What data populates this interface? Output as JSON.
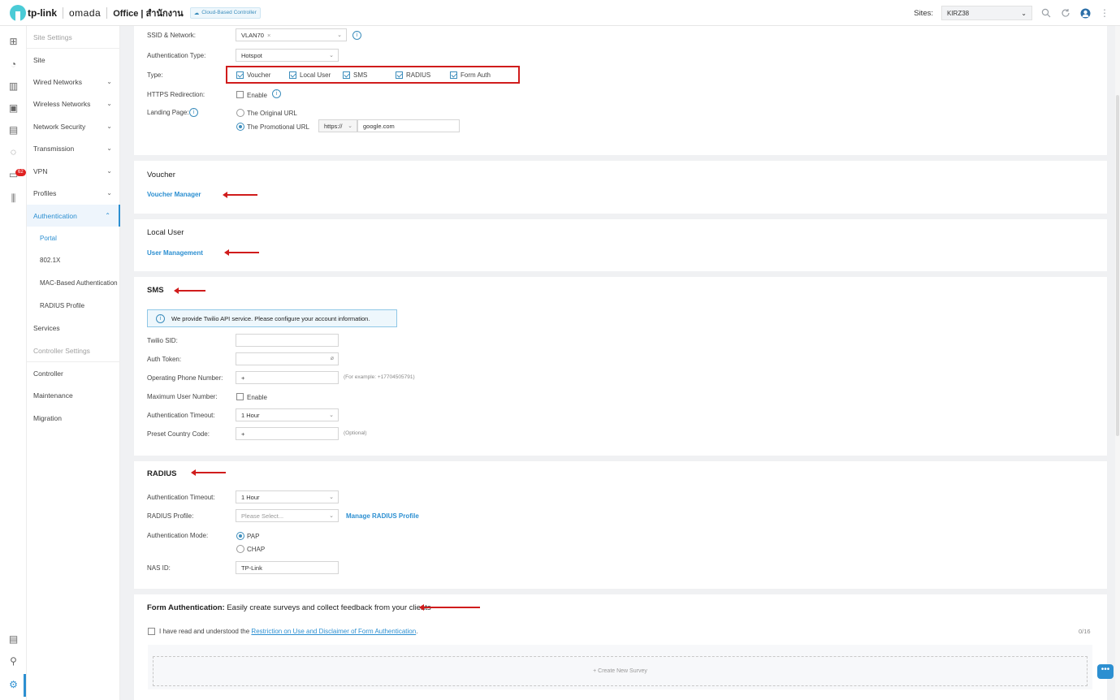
{
  "topbar": {
    "brand": "tp-link",
    "product": "omada",
    "site_title": "Office | สำนักงาน",
    "cloud_badge": "Cloud-Based Controller",
    "sites_label": "Sites:",
    "site_value": "KIRZ38"
  },
  "rail": {
    "badge": "62"
  },
  "nav": {
    "site_settings": "Site Settings",
    "site": "Site",
    "wired": "Wired Networks",
    "wireless": "Wireless Networks",
    "security": "Network Security",
    "transmission": "Transmission",
    "vpn": "VPN",
    "profiles": "Profiles",
    "authentication": "Authentication",
    "portal": "Portal",
    "dot1x": "802.1X",
    "mac": "MAC-Based Authentication",
    "radius_profile": "RADIUS Profile",
    "services": "Services",
    "controller_settings": "Controller Settings",
    "controller": "Controller",
    "maintenance": "Maintenance",
    "migration": "Migration"
  },
  "portal": {
    "ssid_label": "SSID & Network:",
    "ssid_value": "VLAN70",
    "auth_type_label": "Authentication Type:",
    "auth_type_value": "Hotspot",
    "type_label": "Type:",
    "types": [
      "Voucher",
      "Local User",
      "SMS",
      "RADIUS",
      "Form Auth"
    ],
    "https_label": "HTTPS Redirection:",
    "https_enable": "Enable",
    "landing_label": "Landing Page:",
    "landing_original": "The Original URL",
    "landing_promo": "The Promotional URL",
    "protocol": "https://",
    "url": "google.com"
  },
  "voucher": {
    "title": "Voucher",
    "link": "Voucher Manager"
  },
  "local_user": {
    "title": "Local User",
    "link": "User Management"
  },
  "sms": {
    "title": "SMS",
    "note": "We provide Twilio API service. Please configure your account information.",
    "sid_label": "Twilio SID:",
    "token_label": "Auth Token:",
    "phone_label": "Operating Phone Number:",
    "phone_prefix": "+",
    "phone_hint": "(For example: +17704505791)",
    "max_label": "Maximum User Number:",
    "max_enable": "Enable",
    "timeout_label": "Authentication Timeout:",
    "timeout_value": "1 Hour",
    "country_label": "Preset Country Code:",
    "country_prefix": "+",
    "country_hint": "(Optional)"
  },
  "radius": {
    "title": "RADIUS",
    "timeout_label": "Authentication Timeout:",
    "timeout_value": "1 Hour",
    "profile_label": "RADIUS Profile:",
    "profile_placeholder": "Please Select...",
    "manage_link": "Manage RADIUS Profile",
    "mode_label": "Authentication Mode:",
    "mode_pap": "PAP",
    "mode_chap": "CHAP",
    "nas_label": "NAS ID:",
    "nas_value": "TP-Link"
  },
  "form_auth": {
    "title": "Form Authentication:",
    "subtitle": "Easily create surveys and collect feedback from your clients",
    "agree_text": "I have read and understood the ",
    "agree_link": "Restriction on Use and Disclaimer of Form Authentication",
    "agree_end": ".",
    "count": "0/16",
    "create": "+ Create New Survey"
  }
}
